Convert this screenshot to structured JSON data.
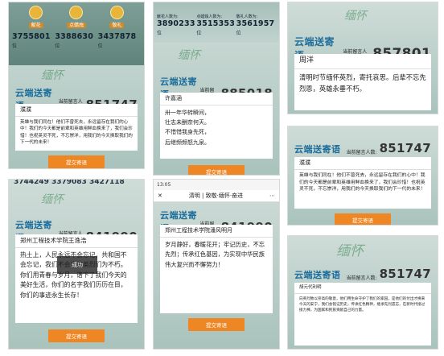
{
  "common": {
    "logo": "云端送寄语",
    "count_label": "当前留言人数:",
    "submit": "提交寄语",
    "hand_logo": "缅怀"
  },
  "p1": {
    "stats": [
      {
        "label": "献花",
        "num": "3755801",
        "unit": "位"
      },
      {
        "label": "点蜡烛",
        "num": "3388630",
        "unit": "位"
      },
      {
        "label": "敬礼",
        "num": "3437878",
        "unit": "位"
      }
    ],
    "count": "851747",
    "name": "濮濮",
    "text": "英雄与我们同在！他们不曾死去，永远留存在我们的心中！我们的今天都是前辈和英雄用鲜血换来了，我们会珍惜！也祝英灵不死，不忘崇洋，用我们的今天换取我们的下一代的未来！"
  },
  "p2": {
    "stats": [
      {
        "label": "献花人数为:",
        "num": "3890233",
        "unit": "位"
      },
      {
        "label": "点蜡烛人数为:",
        "num": "3515353",
        "unit": "位"
      },
      {
        "label": "敬礼人数为:",
        "num": "3561957",
        "unit": "位"
      }
    ],
    "count": "885018",
    "name": "许嘉涵",
    "lines": [
      "卅一年华转瞬间，",
      "壮志未酬奈何天。",
      "不惜惜我身先死，",
      "后继频频怒九泉。"
    ]
  },
  "p3": {
    "count": "857801",
    "name": "周洋",
    "text": "清明时节缅怀英烈，寄托哀思。后辈不忘先烈恩，英雄永垂不朽。"
  },
  "p4": {
    "count": "851747",
    "name": "濮濮",
    "text": "英雄与我们同在！他们不曾死去，永远留存在我们的心中！我们的今天都是前辈和英雄用鲜血换来了，我们会珍惜！也祝英灵不死，不忘崇洋，用我们的今天换取我们的下一代的未来！"
  },
  "p5": {
    "top": "3744249 3379083 3427118",
    "count": "841990",
    "name": "郑州工程技术学院王逸浩",
    "text": "热土上，人民永远不会忘记，共和国不会忘记，我们不会忘记英烈们为不朽。你们用青春与岁月，谱下了我们今天的美好生活，你们的名字我们历历在目，你们的事迹永生长存！",
    "toast": "成功"
  },
  "p6": {
    "time": "13:05",
    "tab": "清明 | 致敬·缅怀·奋进",
    "count": "841990",
    "name": "郑州工程技术学院潘风明月",
    "text": "岁月静好，春暖花开；牢记历史，不忘先烈；传承红色基因，为实现中华民族伟大复兴而不懈努力！"
  },
  "p7": {
    "count": "851747",
    "name": "胡元代利明",
    "text": "向英烈致以崇高的敬意，他们用生命守护了我们的家园，是他们的付出才换来今天的安宁，我们会铭记历史，传承红色精神，继承先烈遗志，在新时代接过接力棒，为国家和民族贡献自己的力量。"
  }
}
